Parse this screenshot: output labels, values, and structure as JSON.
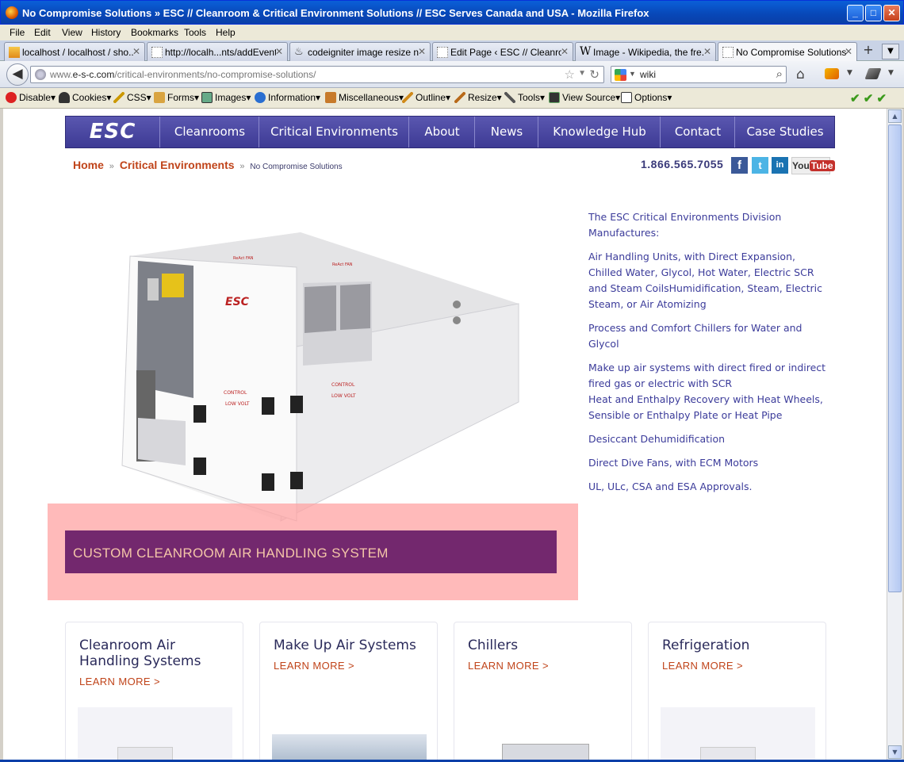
{
  "window": {
    "title": "No Compromise Solutions » ESC // Cleanroom & Critical Environment Solutions // ESC Serves Canada and USA - Mozilla Firefox",
    "min_glyph": "_",
    "max_glyph": "□",
    "close_glyph": "✕"
  },
  "menu": [
    "File",
    "Edit",
    "View",
    "History",
    "Bookmarks",
    "Tools",
    "Help"
  ],
  "tabs": [
    {
      "label": "localhost / localhost / sho...",
      "active": false
    },
    {
      "label": "http://localh...nts/addEvent",
      "active": false
    },
    {
      "label": "codeigniter image resize n...",
      "active": false
    },
    {
      "label": "Edit Page ‹ ESC // Cleanro...",
      "active": false
    },
    {
      "label": "Image - Wikipedia, the fre...",
      "active": false
    },
    {
      "label": "No Compromise Solutions ...",
      "active": true
    }
  ],
  "tab_close": "✕",
  "new_tab": "+",
  "tab_list": "▼",
  "navbar": {
    "back": "◀",
    "url_prefix": "www.",
    "url_domain": "e-s-c.com",
    "url_path": "/critical-environments/no-compromise-solutions/",
    "search_value": "wiki",
    "star": "☆",
    "drop": "▼",
    "reload": "↻",
    "magnifier": "⌕",
    "home": "⌂"
  },
  "devbar": [
    "Disable▾",
    "Cookies▾",
    "CSS▾",
    "Forms▾",
    "Images▾",
    "Information▾",
    "Miscellaneous▾",
    "Outline▾",
    "Resize▾",
    "Tools▾",
    "View Source▾",
    "Options▾"
  ],
  "checkmarks": "✔ ✔ ✔",
  "site": {
    "logo": "ESC",
    "nav": [
      "Cleanrooms",
      "Critical Environments",
      "About",
      "News",
      "Knowledge Hub",
      "Contact",
      "Case Studies"
    ],
    "breadcrumb": {
      "home": "Home",
      "sep": "»",
      "parent": "Critical Environments",
      "current": "No Compromise Solutions"
    },
    "phone": "1.866.565.7055",
    "social": {
      "facebook": "f",
      "twitter": "t",
      "linkedin": "in",
      "youtube_you": "You",
      "youtube_tube": "Tube"
    },
    "hero_caption": "CUSTOM CLEANROOM AIR HANDLING SYSTEM",
    "hero_image_labels": {
      "logo": "ESC",
      "control": "CONTROL",
      "low_volt": "LOW VOLT",
      "react_fan": "ReAct FAN"
    },
    "manufactures": [
      "The ESC Critical Environments Division Manufactures:",
      "Air Handling Units, with Direct Expansion, Chilled Water, Glycol, Hot Water, Electric SCR and Steam CoilsHumidification, Steam, Electric Steam, or Air Atomizing",
      "Process and Comfort Chillers for Water and Glycol",
      "Make up air systems with direct fired or indirect fired gas or electric with SCR",
      "Heat and Enthalpy Recovery with Heat Wheels, Sensible or Enthalpy Plate or Heat Pipe",
      "Desiccant Dehumidification",
      "Direct Dive Fans, with ECM Motors",
      "UL, ULc, CSA and ESA Approvals."
    ],
    "cards": [
      {
        "title": "Cleanroom Air Handling Systems",
        "link": "LEARN MORE >"
      },
      {
        "title": "Make Up Air Systems",
        "link": "LEARN MORE >"
      },
      {
        "title": "Chillers",
        "link": "LEARN MORE >"
      },
      {
        "title": "Refrigeration",
        "link": "LEARN MORE >"
      }
    ]
  },
  "colors": {
    "nav_bg": "#4a47a3",
    "accent_orange": "#c0441a",
    "caption_bg": "#73286e",
    "body_text": "#3b3b9a"
  }
}
